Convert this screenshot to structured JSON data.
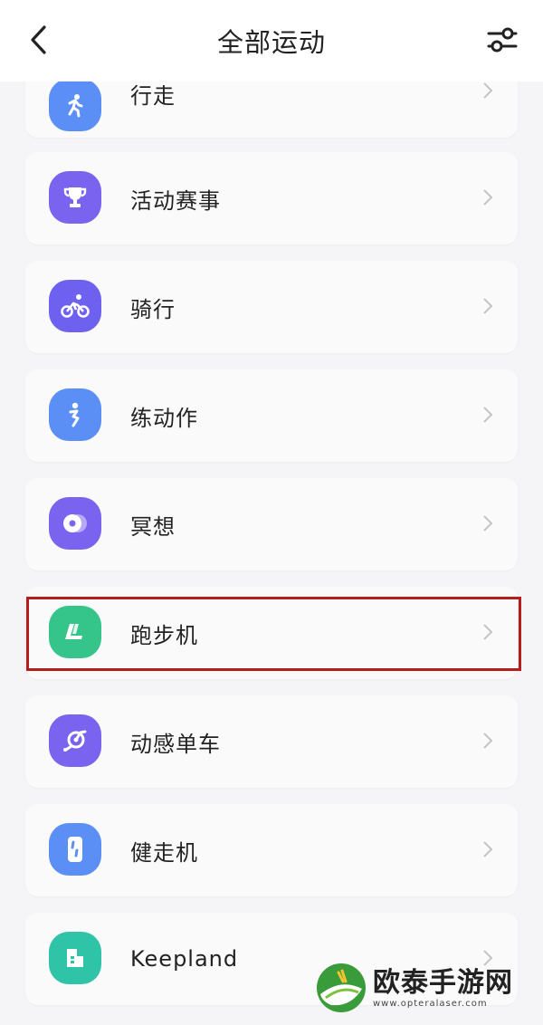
{
  "header": {
    "title": "全部运动",
    "back_icon": "back-arrow-icon",
    "filter_icon": "filter-sliders-icon"
  },
  "sports": [
    {
      "label": "行走",
      "icon": "walking-icon",
      "color": "#5b8ff5"
    },
    {
      "label": "活动赛事",
      "icon": "trophy-icon",
      "color": "#7a63ee"
    },
    {
      "label": "骑行",
      "icon": "cycling-icon",
      "color": "#6f61ef"
    },
    {
      "label": "练动作",
      "icon": "exercise-person-icon",
      "color": "#5b8ff5"
    },
    {
      "label": "冥想",
      "icon": "meditation-icon",
      "color": "#7a63ee"
    },
    {
      "label": "跑步机",
      "icon": "treadmill-icon",
      "color": "#35c48a"
    },
    {
      "label": "动感单车",
      "icon": "spin-bike-icon",
      "color": "#7a63ee"
    },
    {
      "label": "健走机",
      "icon": "walking-machine-icon",
      "color": "#5b8ff5"
    },
    {
      "label": "Keepland",
      "icon": "keepland-icon",
      "color": "#2fc4a8"
    }
  ],
  "highlighted_item": "跑步机",
  "watermark": {
    "name": "欧泰手游网",
    "url": "www.opteralaser.com"
  }
}
